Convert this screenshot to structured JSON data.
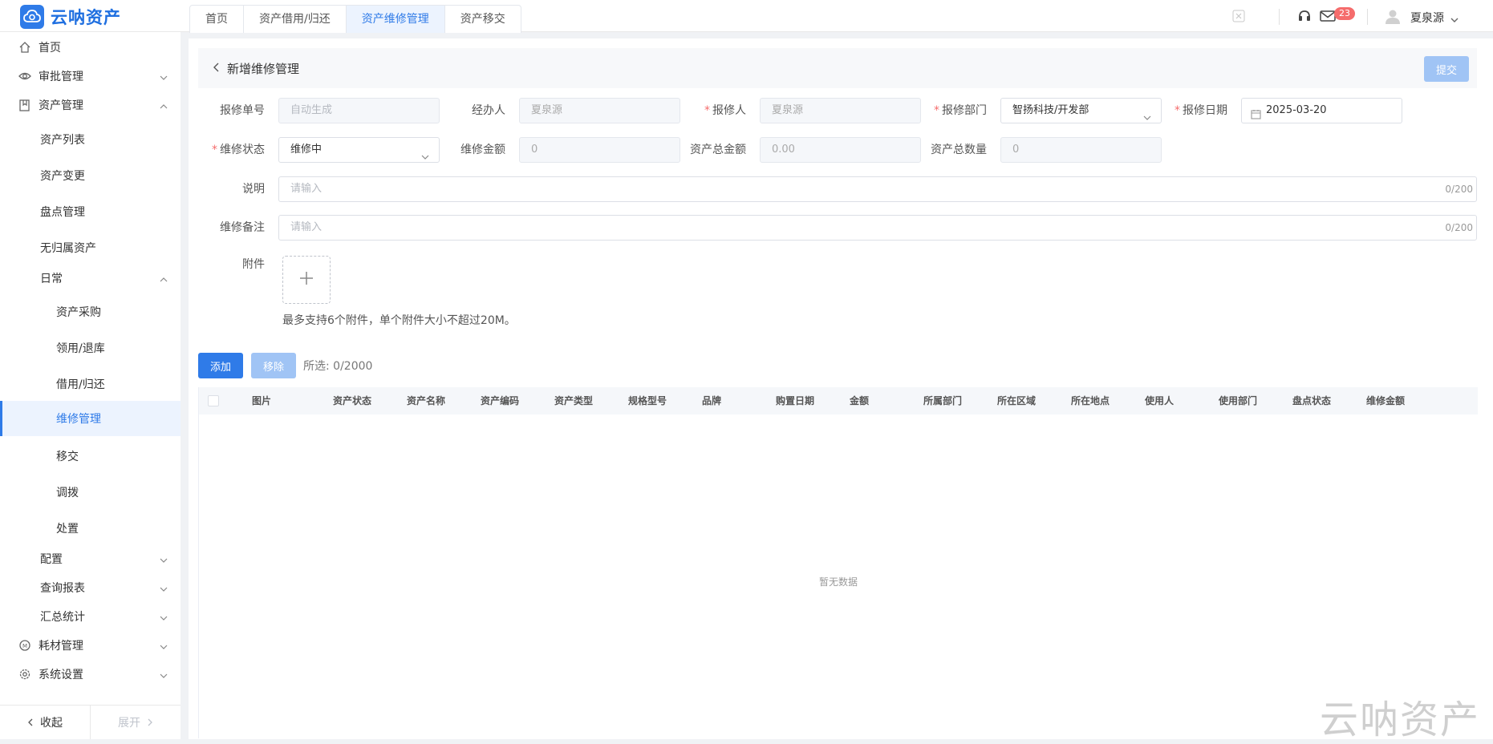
{
  "app": {
    "name": "云呐资产"
  },
  "tabs": [
    {
      "label": "首页"
    },
    {
      "label": "资产借用/归还"
    },
    {
      "label": "资产维修管理"
    },
    {
      "label": "资产移交"
    }
  ],
  "header": {
    "notification_count": "23",
    "user_name": "夏泉源"
  },
  "sidebar": {
    "items": [
      {
        "label": "首页"
      },
      {
        "label": "审批管理"
      },
      {
        "label": "资产管理"
      },
      {
        "label": "资产列表"
      },
      {
        "label": "资产变更"
      },
      {
        "label": "盘点管理"
      },
      {
        "label": "无归属资产"
      },
      {
        "label": "日常"
      },
      {
        "label": "资产采购"
      },
      {
        "label": "领用/退库"
      },
      {
        "label": "借用/归还"
      },
      {
        "label": "维修管理"
      },
      {
        "label": "移交"
      },
      {
        "label": "调拨"
      },
      {
        "label": "处置"
      },
      {
        "label": "配置"
      },
      {
        "label": "查询报表"
      },
      {
        "label": "汇总统计"
      },
      {
        "label": "耗材管理"
      },
      {
        "label": "系统设置"
      }
    ],
    "collapse_label": "收起",
    "expand_label": "展开"
  },
  "page": {
    "title": "新增维修管理",
    "submit_label": "提交"
  },
  "form": {
    "repair_no": {
      "label": "报修单号",
      "placeholder": "自动生成"
    },
    "handler": {
      "label": "经办人",
      "value": "夏泉源"
    },
    "reporter": {
      "label": "报修人",
      "value": "夏泉源"
    },
    "department": {
      "label": "报修部门",
      "value": "智扬科技/开发部"
    },
    "date": {
      "label": "报修日期",
      "value": "2025-03-20"
    },
    "status": {
      "label": "维修状态",
      "value": "维修中"
    },
    "amount": {
      "label": "维修金额",
      "value": "0"
    },
    "total_amount": {
      "label": "资产总金额",
      "value": "0.00"
    },
    "total_qty": {
      "label": "资产总数量",
      "value": "0"
    },
    "description": {
      "label": "说明",
      "placeholder": "请输入",
      "count": "0/200"
    },
    "remark": {
      "label": "维修备注",
      "placeholder": "请输入",
      "count": "0/200"
    },
    "attachment": {
      "label": "附件",
      "hint": "最多支持6个附件，单个附件大小不超过20M。"
    }
  },
  "actions": {
    "add_label": "添加",
    "remove_label": "移除",
    "selected_text": "所选: 0/2000"
  },
  "table": {
    "columns": [
      "图片",
      "资产状态",
      "资产名称",
      "资产编码",
      "资产类型",
      "规格型号",
      "品牌",
      "购置日期",
      "金额",
      "所属部门",
      "所在区域",
      "所在地点",
      "使用人",
      "使用部门",
      "盘点状态",
      "维修金额"
    ],
    "empty_text": "暂无数据"
  },
  "watermark": "云呐资产",
  "colors": {
    "accent": "#2f7be8",
    "required": "#f56c6c",
    "badge": "#f56c6c"
  }
}
